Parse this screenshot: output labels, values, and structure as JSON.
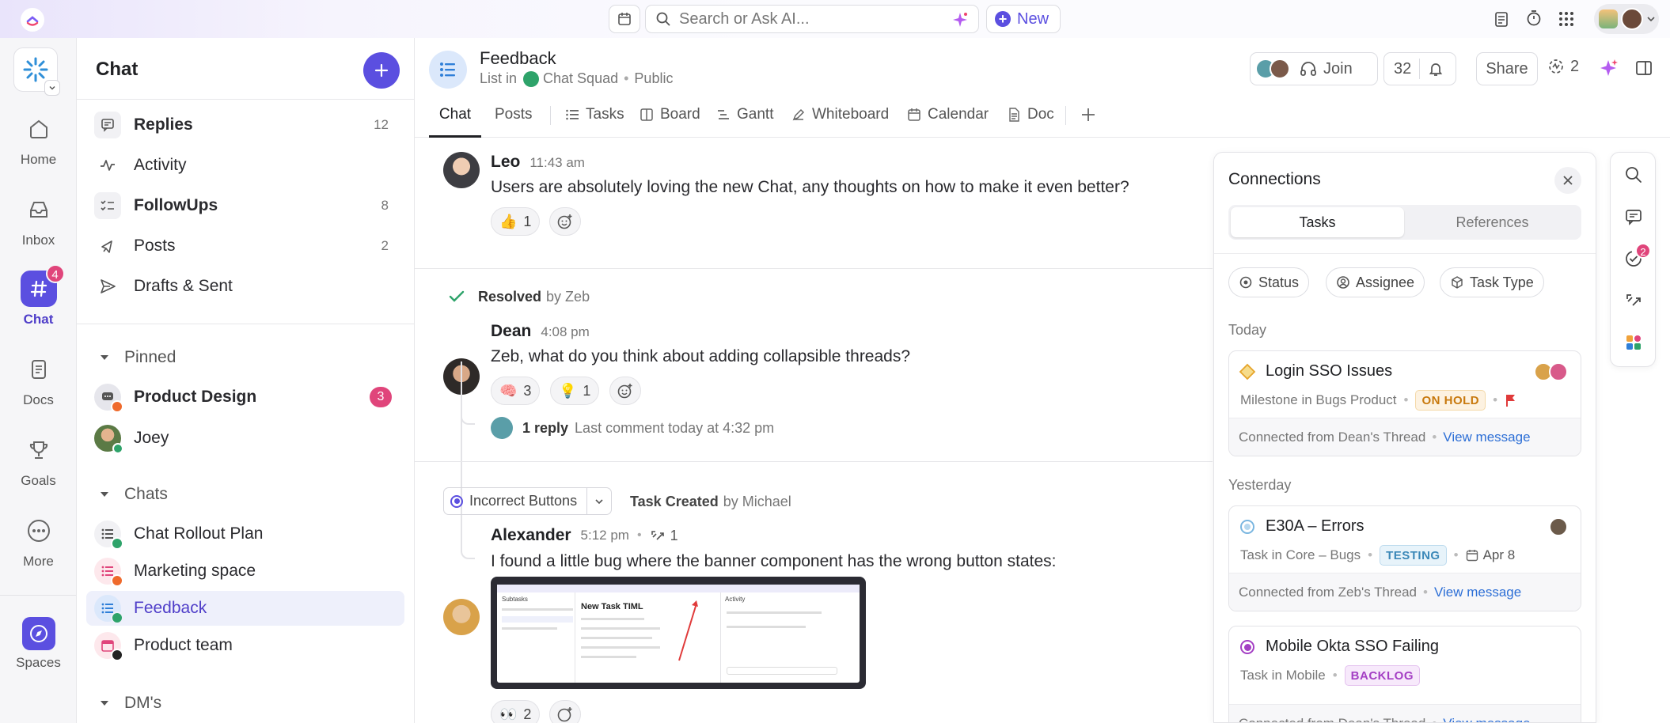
{
  "topbar": {
    "search_placeholder": "Search or Ask AI...",
    "new_label": "New"
  },
  "rail": {
    "items": [
      {
        "label": "Home",
        "icon": "home-icon"
      },
      {
        "label": "Inbox",
        "icon": "inbox-icon"
      },
      {
        "label": "Chat",
        "icon": "hash-icon",
        "badge": "4"
      },
      {
        "label": "Docs",
        "icon": "docs-icon"
      },
      {
        "label": "Goals",
        "icon": "trophy-icon"
      },
      {
        "label": "More",
        "icon": "more-icon"
      },
      {
        "label": "Spaces",
        "icon": "compass-icon"
      }
    ]
  },
  "panel": {
    "title": "Chat",
    "nav": [
      {
        "label": "Replies",
        "count": "12",
        "bold": true,
        "icon": "replies-icon"
      },
      {
        "label": "Activity",
        "count": "",
        "bold": false,
        "icon": "activity-icon"
      },
      {
        "label": "FollowUps",
        "count": "8",
        "bold": true,
        "icon": "followups-icon"
      },
      {
        "label": "Posts",
        "count": "2",
        "bold": false,
        "icon": "posts-icon"
      },
      {
        "label": "Drafts & Sent",
        "count": "",
        "bold": false,
        "icon": "send-icon"
      }
    ],
    "pinned_header": "Pinned",
    "pinned": [
      {
        "label": "Product Design",
        "badge": "3"
      },
      {
        "label": "Joey"
      }
    ],
    "chats_header": "Chats",
    "chats": [
      {
        "label": "Chat Rollout Plan"
      },
      {
        "label": "Marketing space"
      },
      {
        "label": "Feedback"
      },
      {
        "label": "Product team"
      }
    ],
    "dms_header": "DM's"
  },
  "header": {
    "title": "Feedback",
    "list_in": "List in",
    "space": "Chat Squad",
    "visibility": "Public",
    "join_label": "Join",
    "member_count": "32",
    "share_label": "Share",
    "ai_count": "2",
    "tabs": [
      "Chat",
      "Posts",
      "Tasks",
      "Board",
      "Gantt",
      "Whiteboard",
      "Calendar",
      "Doc"
    ]
  },
  "messages": {
    "leo": {
      "name": "Leo",
      "time": "11:43 am",
      "text": "Users are absolutely loving the new Chat, any thoughts on how to make it even better?",
      "reaction_emoji": "👍",
      "reaction_count": "1"
    },
    "resolved": {
      "label": "Resolved",
      "by": "by Zeb"
    },
    "dean": {
      "name": "Dean",
      "time": "4:08 pm",
      "text": "Zeb, what do you think about adding collapsible threads?",
      "r1_emoji": "🧠",
      "r1_count": "3",
      "r2_emoji": "💡",
      "r2_count": "1",
      "reply_count": "1 reply",
      "last_comment": "Last comment today at 4:32 pm"
    },
    "task_chip": "Incorrect Buttons",
    "task_created": "Task Created",
    "task_by": "by Michael",
    "alexander": {
      "name": "Alexander",
      "time": "5:12 pm",
      "sync_count": "1",
      "text": "I found a little bug where the banner component has the wrong button states:",
      "r1_emoji": "👀",
      "r1_count": "2"
    },
    "screenshot_title": "New Task TIML",
    "screenshot_subtasks": "Subtasks",
    "screenshot_activity": "Activity"
  },
  "connections": {
    "title": "Connections",
    "tab_tasks": "Tasks",
    "tab_refs": "References",
    "filters": [
      "Status",
      "Assignee",
      "Task Type"
    ],
    "today": "Today",
    "yesterday": "Yesterday",
    "cards": [
      {
        "title": "Login SSO Issues",
        "sub": "Milestone in Bugs Product",
        "status": "ON HOLD",
        "from": "Connected from Dean's Thread",
        "link": "View message"
      },
      {
        "title": "E30A – Errors",
        "sub": "Task in Core – Bugs",
        "status": "TESTING",
        "date": "Apr 8",
        "from": "Connected from Zeb's Thread",
        "link": "View message"
      },
      {
        "title": "Mobile Okta SSO Failing",
        "sub": "Task in Mobile",
        "status": "BACKLOG",
        "from": "Connected from Dean's Thread",
        "link": "View message"
      }
    ]
  },
  "tools": {
    "badge": "2"
  },
  "colors": {
    "accent": "#5b4fe0",
    "badge": "#e0457b",
    "onhold": "#c8790e",
    "testing": "#3b88b8",
    "backlog": "#a43fc4",
    "link": "#2d6fd6"
  }
}
